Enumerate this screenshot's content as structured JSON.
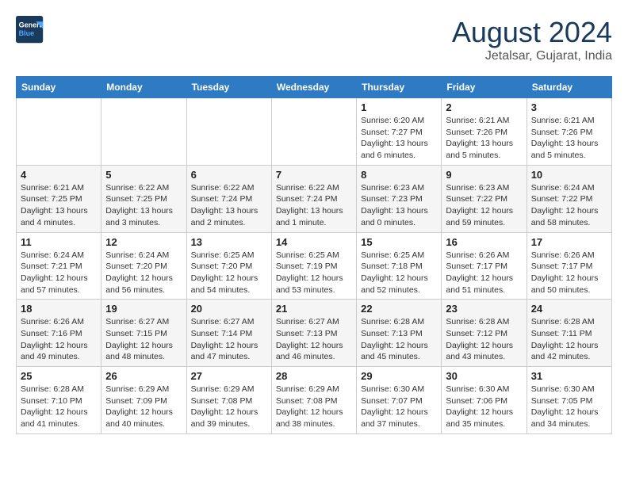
{
  "header": {
    "logo_line1": "General",
    "logo_line2": "Blue",
    "month_year": "August 2024",
    "location": "Jetalsar, Gujarat, India"
  },
  "weekdays": [
    "Sunday",
    "Monday",
    "Tuesday",
    "Wednesday",
    "Thursday",
    "Friday",
    "Saturday"
  ],
  "weeks": [
    [
      {
        "day": "",
        "info": ""
      },
      {
        "day": "",
        "info": ""
      },
      {
        "day": "",
        "info": ""
      },
      {
        "day": "",
        "info": ""
      },
      {
        "day": "1",
        "info": "Sunrise: 6:20 AM\nSunset: 7:27 PM\nDaylight: 13 hours\nand 6 minutes."
      },
      {
        "day": "2",
        "info": "Sunrise: 6:21 AM\nSunset: 7:26 PM\nDaylight: 13 hours\nand 5 minutes."
      },
      {
        "day": "3",
        "info": "Sunrise: 6:21 AM\nSunset: 7:26 PM\nDaylight: 13 hours\nand 5 minutes."
      }
    ],
    [
      {
        "day": "4",
        "info": "Sunrise: 6:21 AM\nSunset: 7:25 PM\nDaylight: 13 hours\nand 4 minutes."
      },
      {
        "day": "5",
        "info": "Sunrise: 6:22 AM\nSunset: 7:25 PM\nDaylight: 13 hours\nand 3 minutes."
      },
      {
        "day": "6",
        "info": "Sunrise: 6:22 AM\nSunset: 7:24 PM\nDaylight: 13 hours\nand 2 minutes."
      },
      {
        "day": "7",
        "info": "Sunrise: 6:22 AM\nSunset: 7:24 PM\nDaylight: 13 hours\nand 1 minute."
      },
      {
        "day": "8",
        "info": "Sunrise: 6:23 AM\nSunset: 7:23 PM\nDaylight: 13 hours\nand 0 minutes."
      },
      {
        "day": "9",
        "info": "Sunrise: 6:23 AM\nSunset: 7:22 PM\nDaylight: 12 hours\nand 59 minutes."
      },
      {
        "day": "10",
        "info": "Sunrise: 6:24 AM\nSunset: 7:22 PM\nDaylight: 12 hours\nand 58 minutes."
      }
    ],
    [
      {
        "day": "11",
        "info": "Sunrise: 6:24 AM\nSunset: 7:21 PM\nDaylight: 12 hours\nand 57 minutes."
      },
      {
        "day": "12",
        "info": "Sunrise: 6:24 AM\nSunset: 7:20 PM\nDaylight: 12 hours\nand 56 minutes."
      },
      {
        "day": "13",
        "info": "Sunrise: 6:25 AM\nSunset: 7:20 PM\nDaylight: 12 hours\nand 54 minutes."
      },
      {
        "day": "14",
        "info": "Sunrise: 6:25 AM\nSunset: 7:19 PM\nDaylight: 12 hours\nand 53 minutes."
      },
      {
        "day": "15",
        "info": "Sunrise: 6:25 AM\nSunset: 7:18 PM\nDaylight: 12 hours\nand 52 minutes."
      },
      {
        "day": "16",
        "info": "Sunrise: 6:26 AM\nSunset: 7:17 PM\nDaylight: 12 hours\nand 51 minutes."
      },
      {
        "day": "17",
        "info": "Sunrise: 6:26 AM\nSunset: 7:17 PM\nDaylight: 12 hours\nand 50 minutes."
      }
    ],
    [
      {
        "day": "18",
        "info": "Sunrise: 6:26 AM\nSunset: 7:16 PM\nDaylight: 12 hours\nand 49 minutes."
      },
      {
        "day": "19",
        "info": "Sunrise: 6:27 AM\nSunset: 7:15 PM\nDaylight: 12 hours\nand 48 minutes."
      },
      {
        "day": "20",
        "info": "Sunrise: 6:27 AM\nSunset: 7:14 PM\nDaylight: 12 hours\nand 47 minutes."
      },
      {
        "day": "21",
        "info": "Sunrise: 6:27 AM\nSunset: 7:13 PM\nDaylight: 12 hours\nand 46 minutes."
      },
      {
        "day": "22",
        "info": "Sunrise: 6:28 AM\nSunset: 7:13 PM\nDaylight: 12 hours\nand 45 minutes."
      },
      {
        "day": "23",
        "info": "Sunrise: 6:28 AM\nSunset: 7:12 PM\nDaylight: 12 hours\nand 43 minutes."
      },
      {
        "day": "24",
        "info": "Sunrise: 6:28 AM\nSunset: 7:11 PM\nDaylight: 12 hours\nand 42 minutes."
      }
    ],
    [
      {
        "day": "25",
        "info": "Sunrise: 6:28 AM\nSunset: 7:10 PM\nDaylight: 12 hours\nand 41 minutes."
      },
      {
        "day": "26",
        "info": "Sunrise: 6:29 AM\nSunset: 7:09 PM\nDaylight: 12 hours\nand 40 minutes."
      },
      {
        "day": "27",
        "info": "Sunrise: 6:29 AM\nSunset: 7:08 PM\nDaylight: 12 hours\nand 39 minutes."
      },
      {
        "day": "28",
        "info": "Sunrise: 6:29 AM\nSunset: 7:08 PM\nDaylight: 12 hours\nand 38 minutes."
      },
      {
        "day": "29",
        "info": "Sunrise: 6:30 AM\nSunset: 7:07 PM\nDaylight: 12 hours\nand 37 minutes."
      },
      {
        "day": "30",
        "info": "Sunrise: 6:30 AM\nSunset: 7:06 PM\nDaylight: 12 hours\nand 35 minutes."
      },
      {
        "day": "31",
        "info": "Sunrise: 6:30 AM\nSunset: 7:05 PM\nDaylight: 12 hours\nand 34 minutes."
      }
    ]
  ]
}
